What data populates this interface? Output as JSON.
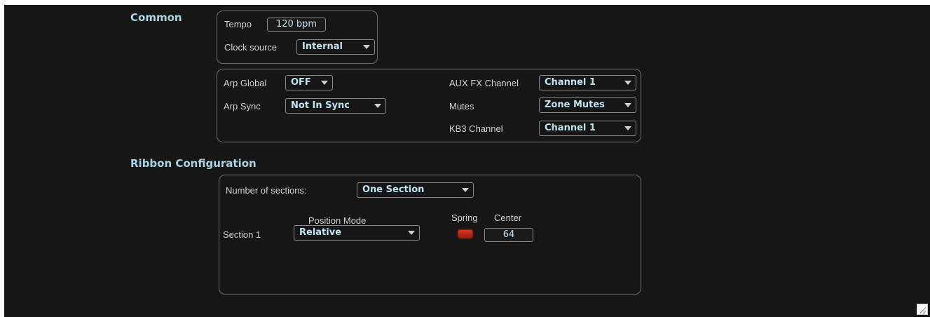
{
  "common": {
    "title": "Common",
    "tempo_label": "Tempo",
    "tempo_value": "120 bpm",
    "clock_source_label": "Clock source",
    "clock_source_value": "Internal"
  },
  "global": {
    "arp_global_label": "Arp Global",
    "arp_global_value": "OFF",
    "arp_sync_label": "Arp Sync",
    "arp_sync_value": "Not In Sync",
    "aux_fx_label": "AUX FX Channel",
    "aux_fx_value": "Channel 1",
    "mutes_label": "Mutes",
    "mutes_value": "Zone Mutes",
    "kb3_label": "KB3 Channel",
    "kb3_value": "Channel 1"
  },
  "ribbon": {
    "title": "Ribbon Configuration",
    "num_sections_label": "Number of sections:",
    "num_sections_value": "One Section",
    "position_mode_header": "Position Mode",
    "spring_header": "Spring",
    "center_header": "Center",
    "section1_label": "Section 1",
    "section1_position_mode": "Relative",
    "section1_spring_on": true,
    "section1_center": "64"
  },
  "colors": {
    "background": "#161616",
    "accent_text": "#a6d5e2",
    "spring_active": "#d23a25"
  }
}
